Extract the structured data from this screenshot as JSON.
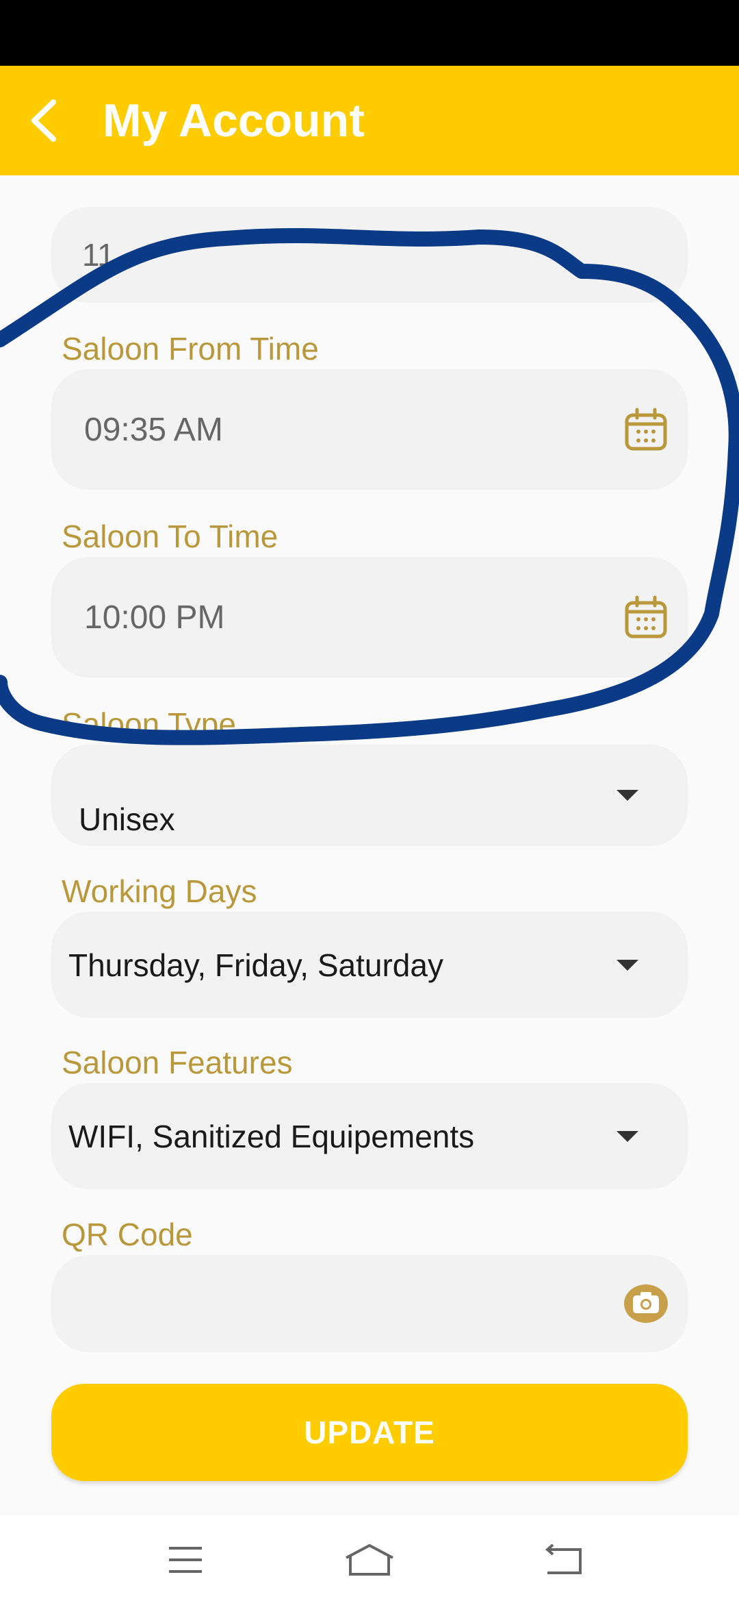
{
  "app_bar": {
    "title": "My Account",
    "back_icon": "chevron-left-icon"
  },
  "form": {
    "partial_field_value": "11",
    "from_time": {
      "label": "Saloon From Time",
      "value": "09:35 AM",
      "icon": "calendar-icon"
    },
    "to_time": {
      "label": "Saloon To Time",
      "value": "10:00 PM",
      "icon": "calendar-icon"
    },
    "saloon_type": {
      "label": "Saloon Type",
      "value": "Unisex"
    },
    "working_days": {
      "label": "Working Days",
      "value": "Thursday, Friday, Saturday"
    },
    "features": {
      "label": "Saloon Features",
      "value": "WIFI, Sanitized Equipements"
    },
    "qr_code": {
      "label": "QR Code",
      "value": "",
      "icon": "camera-icon"
    }
  },
  "update_button": {
    "label": "UPDATE"
  },
  "colors": {
    "accent": "#ffcc00",
    "label": "#b8983a",
    "field_bg": "#f2f2f2",
    "annotation": "#0b3a86"
  },
  "nav_bar": {
    "icons": [
      "menu-icon",
      "home-icon",
      "back-icon"
    ]
  }
}
